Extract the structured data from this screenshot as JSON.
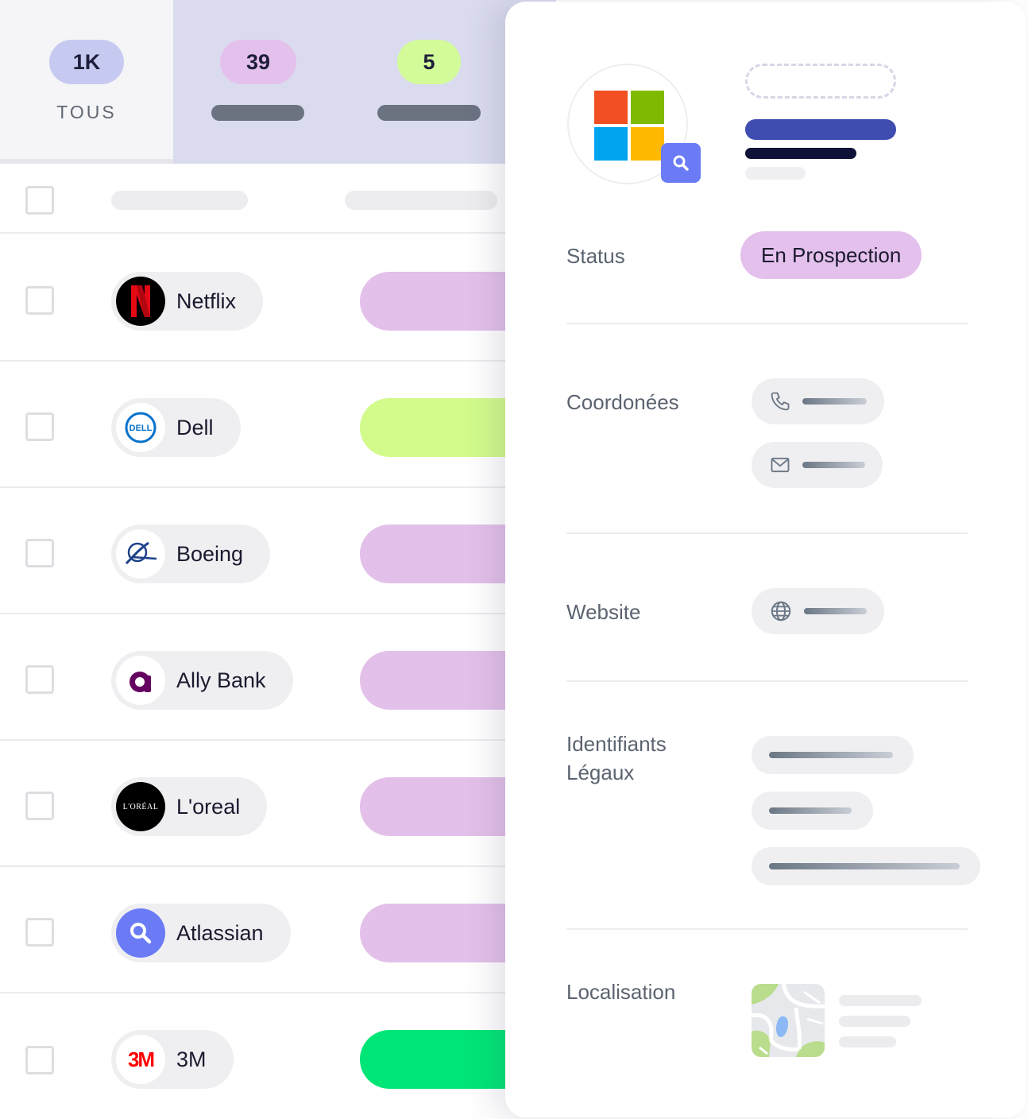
{
  "tabs": [
    {
      "count": "1K",
      "label": "TOUS",
      "color": "#c7caf0"
    },
    {
      "count": "39",
      "color": "#e4c0ec"
    },
    {
      "count": "5",
      "color": "#d4fb9a"
    }
  ],
  "companies": [
    {
      "name": "Netflix",
      "logo": "netflix-logo",
      "status_color": "#e3c0e9"
    },
    {
      "name": "Dell",
      "logo": "dell-logo",
      "status_color": "#d2fb8c"
    },
    {
      "name": "Boeing",
      "logo": "boeing-logo",
      "status_color": "#e3c0e9"
    },
    {
      "name": "Ally Bank",
      "logo": "ally-logo",
      "status_color": "#e3c0e9"
    },
    {
      "name": "L'oreal",
      "logo": "loreal-logo",
      "logo_text": "L'ORÉAL",
      "status_color": "#e3c0e9"
    },
    {
      "name": "Atlassian",
      "logo": "search-logo",
      "status_color": "#e3c0e9"
    },
    {
      "name": "3M",
      "logo": "3m-logo",
      "logo_text": "3M",
      "status_color": "#00e676"
    }
  ],
  "detail": {
    "logo": "microsoft-logo",
    "status_label": "Status",
    "status_value": "En Prospection",
    "contact_label": "Coordonées",
    "website_label": "Website",
    "legal_label_1": "Identifiants",
    "legal_label_2": "Légaux",
    "location_label": "Localisation"
  },
  "icons": {
    "phone": "phone-icon",
    "mail": "mail-icon",
    "globe": "globe-icon",
    "map": "map-icon",
    "search": "search-icon"
  }
}
